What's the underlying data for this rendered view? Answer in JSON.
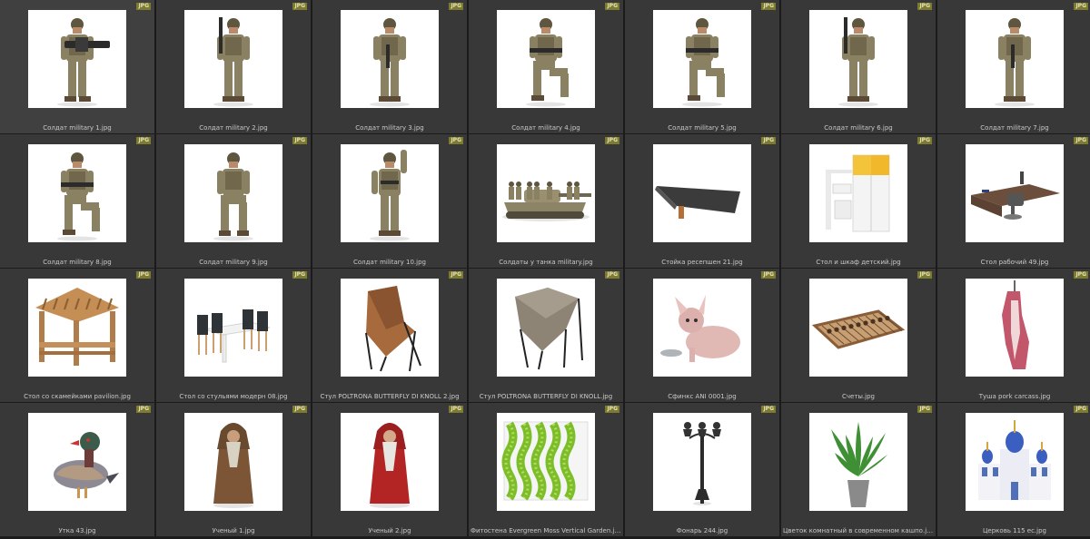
{
  "badge_colors": {
    "background": "#7d7a31",
    "text": "#e6e3b0"
  },
  "items": [
    {
      "name": "Солдат military 1.jpg",
      "badge": "JPG",
      "icon": "soldier-minigun-icon"
    },
    {
      "name": "Солдат military 2.jpg",
      "badge": "JPG",
      "icon": "soldier-rifle-icon"
    },
    {
      "name": "Солдат military 3.jpg",
      "badge": "JPG",
      "icon": "soldier-standing-icon"
    },
    {
      "name": "Солдат military 4.jpg",
      "badge": "JPG",
      "icon": "soldier-kneeling-icon"
    },
    {
      "name": "Солдат military 5.jpg",
      "badge": "JPG",
      "icon": "soldier-kneeling-icon"
    },
    {
      "name": "Солдат military 6.jpg",
      "badge": "JPG",
      "icon": "soldier-rifle-icon"
    },
    {
      "name": "Солдат military 7.jpg",
      "badge": "JPG",
      "icon": "soldier-standing-icon"
    },
    {
      "name": "Солдат military 8.jpg",
      "badge": "JPG",
      "icon": "soldier-kneeling-icon"
    },
    {
      "name": "Солдат military 9.jpg",
      "badge": "JPG",
      "icon": "soldier-sitting-icon"
    },
    {
      "name": "Солдат military 10.jpg",
      "badge": "JPG",
      "icon": "soldier-waving-icon"
    },
    {
      "name": "Солдаты у танка military.jpg",
      "badge": "JPG",
      "icon": "tank-icon"
    },
    {
      "name": "Стойка ресепшен 21.jpg",
      "badge": "JPG",
      "icon": "reception-desk-icon"
    },
    {
      "name": "Стол и шкаф детский.jpg",
      "badge": "JPG",
      "icon": "kids-desk-wardrobe-icon"
    },
    {
      "name": "Стол рабочий 49.jpg",
      "badge": "JPG",
      "icon": "office-desk-icon"
    },
    {
      "name": "Стол со скамейками pavilion.jpg",
      "badge": "JPG",
      "icon": "pavilion-icon"
    },
    {
      "name": "Стол со стульями модерн 08.jpg",
      "badge": "JPG",
      "icon": "dining-set-icon"
    },
    {
      "name": "Стул POLTRONA BUTTERFLY DI KNOLL 2.jpg",
      "badge": "JPG",
      "icon": "butterfly-chair-leather-icon"
    },
    {
      "name": "Стул POLTRONA BUTTERFLY DI KNOLL.jpg",
      "badge": "JPG",
      "icon": "butterfly-chair-fabric-icon"
    },
    {
      "name": "Сфинкс ANI 0001.jpg",
      "badge": "JPG",
      "icon": "sphynx-cat-icon"
    },
    {
      "name": "Счеты.jpg",
      "badge": "JPG",
      "icon": "abacus-icon"
    },
    {
      "name": "Туша pork carcass.jpg",
      "badge": "JPG",
      "icon": "pork-carcass-icon"
    },
    {
      "name": "Утка 43.jpg",
      "badge": "JPG",
      "icon": "duck-icon"
    },
    {
      "name": "Ученый 1.jpg",
      "badge": "JPG",
      "icon": "scholar-brown-icon"
    },
    {
      "name": "Ученый 2.jpg",
      "badge": "JPG",
      "icon": "scholar-red-icon"
    },
    {
      "name": "Фитостена Evergreen Moss Vertical Garden.jpg",
      "badge": "JPG",
      "icon": "moss-wall-icon"
    },
    {
      "name": "Фонарь 244.jpg",
      "badge": "JPG",
      "icon": "street-lamp-icon"
    },
    {
      "name": "Цветок комнатный в современном кашпо.jpg",
      "badge": "JPG",
      "icon": "potted-plant-icon"
    },
    {
      "name": "Церковь 115 ес.jpg",
      "badge": "JPG",
      "icon": "church-icon"
    }
  ]
}
